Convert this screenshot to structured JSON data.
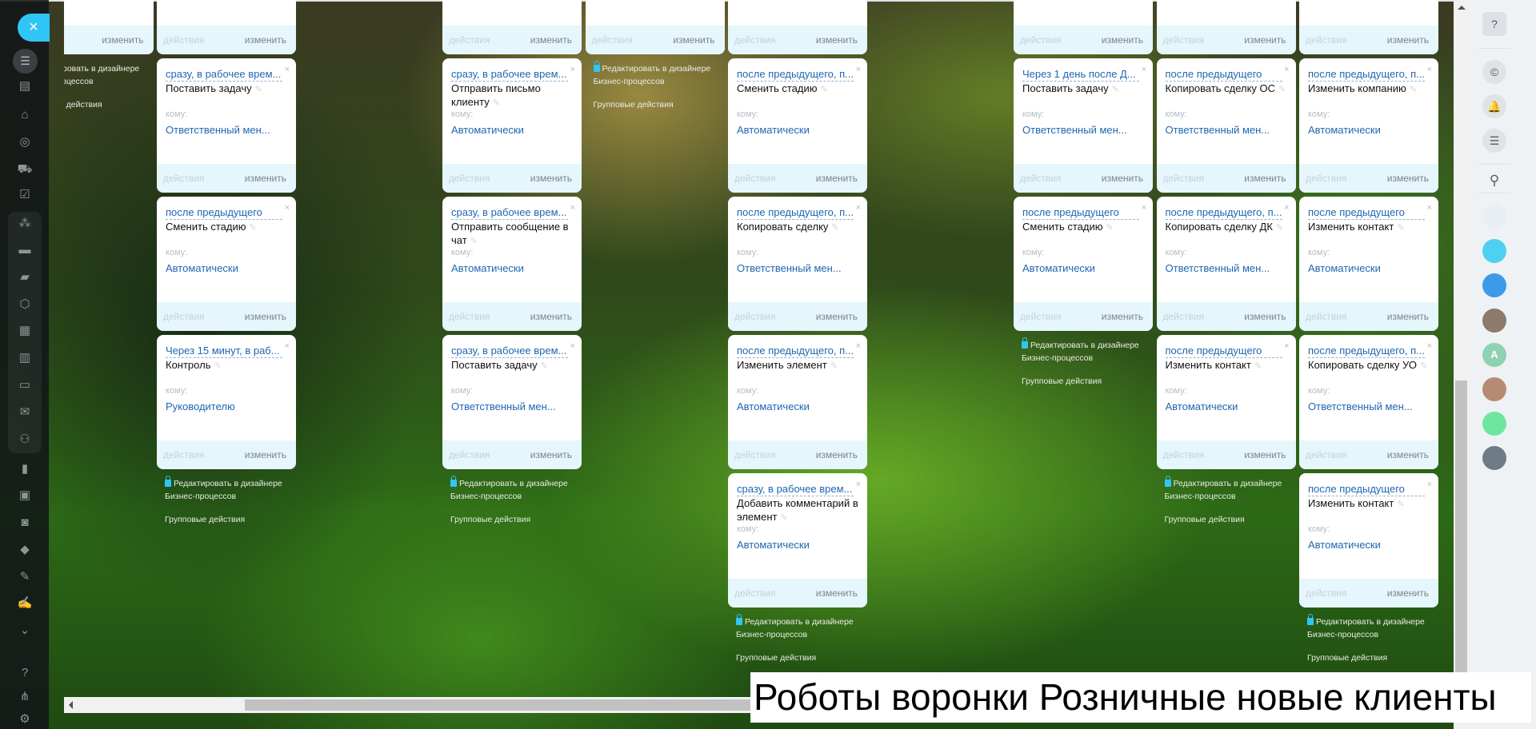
{
  "labels": {
    "to": "кому:",
    "actions": "действия",
    "edit": "изменить",
    "edit_bp_line1": "Редактировать в дизайнере",
    "edit_bp_line2": "Бизнес-процессов",
    "group_actions": "Групповые действия",
    "close": "×",
    "delete": "×",
    "pencil": "✎"
  },
  "columns": [
    {
      "cards": [
        {
          "partial": true
        }
      ],
      "links": true
    },
    {
      "cards": [
        {
          "partial": true
        },
        {
          "trigger": "сразу, в рабочее врем...",
          "title": "Поставить задачу",
          "recipient": "Ответственный мен..."
        },
        {
          "trigger": "после предыдущего",
          "title": "Сменить стадию",
          "recipient": "Автоматически"
        },
        {
          "trigger": "Через 15 минут, в раб...",
          "title": "Контроль",
          "recipient": "Руководителю"
        }
      ],
      "links": true
    },
    {
      "cards": [],
      "links": false
    },
    {
      "cards": [
        {
          "partial": true
        },
        {
          "trigger": "сразу, в рабочее врем...",
          "title": "Отправить письмо клиенту",
          "recipient": "Автоматически"
        },
        {
          "trigger": "сразу, в рабочее врем...",
          "title": "Отправить сообщение в чат",
          "recipient": "Автоматически"
        },
        {
          "trigger": "сразу, в рабочее врем...",
          "title": "Поставить задачу",
          "recipient": "Ответственный мен..."
        }
      ],
      "links": true
    },
    {
      "cards": [
        {
          "partial": true
        }
      ],
      "links": true
    },
    {
      "cards": [
        {
          "partial": true
        },
        {
          "trigger": "после предыдущего, п...",
          "title": "Сменить стадию",
          "recipient": "Автоматически"
        },
        {
          "trigger": "после предыдущего, п...",
          "title": "Копировать сделку",
          "recipient": "Ответственный мен..."
        },
        {
          "trigger": "после предыдущего, п...",
          "title": "Изменить элемент",
          "recipient": "Автоматически"
        },
        {
          "trigger": "сразу, в рабочее врем...",
          "title": "Добавить комментарий в элемент",
          "recipient": "Автоматически"
        }
      ],
      "links": true
    },
    {
      "cards": [],
      "links": false
    },
    {
      "cards": [
        {
          "partial": true
        },
        {
          "trigger": "Через 1 день после Д...",
          "title": "Поставить задачу",
          "recipient": "Ответственный мен..."
        },
        {
          "trigger": "после предыдущего",
          "title": "Сменить стадию",
          "recipient": "Автоматически"
        }
      ],
      "links": true
    },
    {
      "cards": [
        {
          "partial": true
        },
        {
          "trigger": "после предыдущего",
          "title": "Копировать сделку ОС",
          "recipient": "Ответственный мен..."
        },
        {
          "trigger": "после предыдущего, п...",
          "title": "Копировать сделку ДК",
          "recipient": "Ответственный мен..."
        },
        {
          "trigger": "после предыдущего",
          "title": "Изменить контакт",
          "recipient": "Автоматически"
        }
      ],
      "links": true
    },
    {
      "cards": [
        {
          "partial": true
        },
        {
          "trigger": "после предыдущего, п...",
          "title": "Изменить компанию",
          "recipient": "Автоматически"
        },
        {
          "trigger": "после предыдущего",
          "title": "Изменить контакт",
          "recipient": "Автоматически"
        },
        {
          "trigger": "после предыдущего, п...",
          "title": "Копировать сделку УО",
          "recipient": "Ответственный мен..."
        },
        {
          "trigger": "после предыдущего",
          "title": "Изменить контакт",
          "recipient": "Автоматически"
        }
      ],
      "links": true
    }
  ],
  "left_menu": {
    "filter_glyph": "☰",
    "items": [
      {
        "name": "tasks-calendar-icon",
        "glyph": "▤"
      },
      {
        "name": "shop-icon",
        "glyph": "⌂"
      },
      {
        "name": "target-icon",
        "glyph": "◎"
      },
      {
        "name": "cart-icon",
        "glyph": "⛟"
      },
      {
        "name": "task-check-icon",
        "glyph": "☑"
      },
      {
        "name": "crm-funnel-icon",
        "glyph": "⁂"
      },
      {
        "name": "window-icon",
        "glyph": "▬"
      },
      {
        "name": "chat-icon",
        "glyph": "▰"
      },
      {
        "name": "hexagon-icon",
        "glyph": "⬡"
      },
      {
        "name": "calendar-icon",
        "glyph": "▦"
      },
      {
        "name": "document-icon",
        "glyph": "▥"
      },
      {
        "name": "drive-icon",
        "glyph": "▭"
      },
      {
        "name": "mail-icon",
        "glyph": "✉"
      },
      {
        "name": "users-icon",
        "glyph": "⚇"
      },
      {
        "name": "analytics-icon",
        "glyph": "▮"
      },
      {
        "name": "contact-card-icon",
        "glyph": "▣"
      },
      {
        "name": "robot-icon",
        "glyph": "◙"
      },
      {
        "name": "box-icon",
        "glyph": "◆"
      },
      {
        "name": "edit-document-icon",
        "glyph": "✎"
      },
      {
        "name": "signature-icon",
        "glyph": "✍"
      },
      {
        "name": "more-chevron-icon",
        "glyph": "⌄"
      },
      {
        "name": "help-icon",
        "glyph": "?"
      },
      {
        "name": "network-icon",
        "glyph": "⋔"
      },
      {
        "name": "settings-icon",
        "glyph": "⚙"
      }
    ]
  },
  "right_panel": {
    "buttons": [
      {
        "name": "help-icon",
        "glyph": "?"
      },
      {
        "name": "copilot-icon",
        "glyph": "©"
      },
      {
        "name": "bell-icon",
        "glyph": "🔔"
      },
      {
        "name": "chat-search-icon",
        "glyph": "☰"
      },
      {
        "name": "search-icon",
        "glyph": "⚲"
      }
    ],
    "avatars": [
      {
        "name": "robot-avatar",
        "text": "",
        "color": "#e9eef2"
      },
      {
        "name": "chat-avatar",
        "text": "",
        "color": "#4fd0f0"
      },
      {
        "name": "vk-dog-avatar",
        "text": "",
        "color": "#3d9ae8"
      },
      {
        "name": "user-avatar",
        "text": "",
        "color": "#8d7a6a"
      },
      {
        "name": "user-a-avatar",
        "text": "A",
        "color": "#8fd1b3"
      },
      {
        "name": "user-avatar",
        "text": "",
        "color": "#b58c73"
      },
      {
        "name": "news-avatar",
        "text": "",
        "color": "#6ee6a0"
      },
      {
        "name": "user-avatar",
        "text": "",
        "color": "#6e7c88"
      }
    ]
  },
  "caption": "Роботы воронки Розничные новые клиенты",
  "colors": {
    "accent": "#2fc6f6",
    "link": "#2067b0",
    "card_footer": "#e5f6fc"
  }
}
